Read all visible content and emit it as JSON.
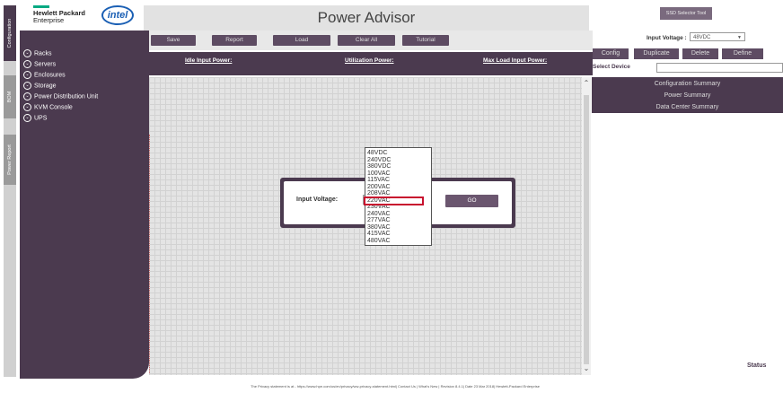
{
  "left_tabs": [
    {
      "label": "Configuration",
      "active": true
    },
    {
      "label": "BOM",
      "active": false
    },
    {
      "label": "Power Report",
      "active": false
    }
  ],
  "brand": {
    "hpe_line1": "Hewlett Packard",
    "hpe_line2": "Enterprise",
    "intel": "intel"
  },
  "app_title": "Power Advisor",
  "toolbar": [
    "Save",
    "Report",
    "Load",
    "Clear All",
    "Tutorial"
  ],
  "nav_items": [
    "Racks",
    "Servers",
    "Enclosures",
    "Storage",
    "Power Distribution Unit",
    "KVM Console",
    "UPS"
  ],
  "power_labels": {
    "idle": "Idle Input Power:",
    "utilization": "Utilization Power:",
    "max_load": "Max Load Input Power:"
  },
  "modal": {
    "label": "Input Voltage:",
    "go_label": "GO",
    "options": [
      "48VDC",
      "240VDC",
      "380VDC",
      "100VAC",
      "115VAC",
      "200VAC",
      "208VAC",
      "220VAC",
      "230VAC",
      "240VAC",
      "277VAC",
      "380VAC",
      "415VAC",
      "480VAC"
    ],
    "highlighted": "220VAC"
  },
  "right_panel": {
    "ssd_button": "SSD Selector Tool",
    "input_voltage_label": "Input Voltage :",
    "input_voltage_value": "48VDC",
    "buttons": [
      "Config",
      "Duplicate",
      "Delete",
      "Define"
    ],
    "select_device_label": "Select Device",
    "summaries": [
      "Configuration Summary",
      "Power Summary",
      "Data Center Summary"
    ],
    "status_label": "Status"
  },
  "footer": "The Privacy statement is at - https://www.hpe.com/us/en/privacy/ww-privacy-statement.html| Contact Us | What's New | Revision 8.4.1| Date 23 Mar 2018| Hewlett-Packard Enterprise",
  "colors": {
    "accent": "#4b3a4f",
    "button": "#5e4c63",
    "highlight": "#c8102e",
    "hpe_green": "#01a982",
    "intel_blue": "#1a5fb4"
  }
}
